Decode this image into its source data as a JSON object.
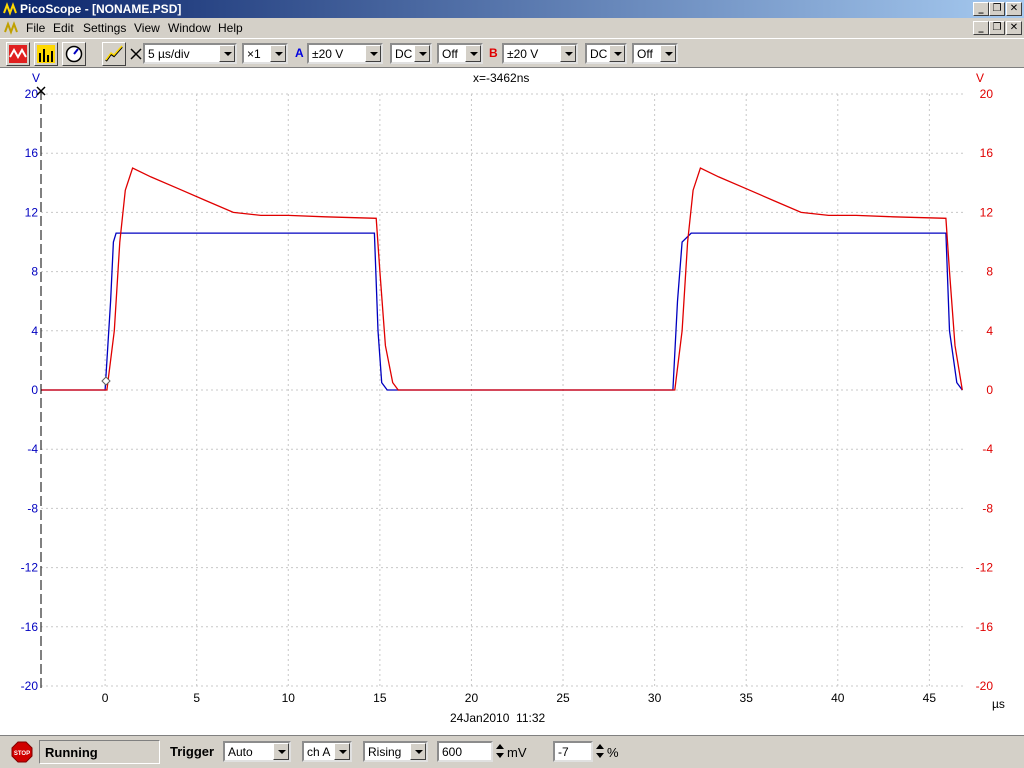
{
  "window": {
    "title": "PicoScope - [NONAME.PSD]"
  },
  "menu": {
    "items": [
      "File",
      "Edit",
      "Settings",
      "View",
      "Window",
      "Help"
    ]
  },
  "toolbar": {
    "timebase": "5 µs/div",
    "multiplier": "×1",
    "channel_a": {
      "label": "A",
      "range": "±20 V",
      "coupling": "DC",
      "offset": "Off"
    },
    "channel_b": {
      "label": "B",
      "range": "±20 V",
      "coupling": "DC",
      "offset": "Off"
    }
  },
  "plot": {
    "cursor_readout": "x=-3462ns",
    "left_unit": "V",
    "right_unit": "V",
    "x_unit": "µs",
    "timestamp": "24Jan2010  11:32"
  },
  "chart_data": {
    "type": "line",
    "xlim": [
      -3.5,
      47
    ],
    "ylim": [
      -20,
      20
    ],
    "x_ticks": [
      "0",
      "5",
      "10",
      "15",
      "20",
      "25",
      "30",
      "35",
      "40",
      "45"
    ],
    "y_ticks": [
      "20",
      "16",
      "12",
      "8",
      "4",
      "0",
      "-4",
      "-8",
      "-12",
      "-16",
      "-20"
    ],
    "grid": true,
    "series": [
      {
        "color": "#0000c0",
        "axis": "left",
        "x": [
          -3.5,
          0,
          0.3,
          0.45,
          0.6,
          5,
          10,
          14.7,
          14.9,
          15.1,
          15.4,
          20,
          30,
          31,
          31.25,
          31.5,
          32,
          40,
          45.9,
          46.1,
          46.5,
          46.8
        ],
        "y": [
          0,
          0,
          6,
          10,
          10.6,
          10.6,
          10.6,
          10.6,
          4,
          0.5,
          0,
          0,
          0,
          0,
          6,
          10,
          10.6,
          10.6,
          10.6,
          4,
          0.5,
          0
        ]
      },
      {
        "color": "#e00000",
        "axis": "left",
        "x": [
          -3.5,
          0.1,
          0.5,
          0.8,
          1.1,
          1.5,
          2.5,
          4,
          5.5,
          7,
          8.5,
          10,
          12,
          14.8,
          15,
          15.3,
          15.7,
          16,
          20,
          30,
          31.1,
          31.5,
          31.8,
          32.1,
          32.5,
          33.5,
          35,
          36.5,
          38,
          39.5,
          41,
          43,
          45.9,
          46.1,
          46.4,
          46.8
        ],
        "y": [
          0,
          0,
          4,
          10,
          13.5,
          15,
          14.4,
          13.6,
          12.8,
          12,
          11.8,
          11.8,
          11.7,
          11.6,
          8,
          3,
          0.5,
          0,
          0,
          0,
          0,
          4,
          10,
          13.5,
          15,
          14.4,
          13.6,
          12.8,
          12,
          11.8,
          11.8,
          11.7,
          11.6,
          8,
          3,
          0
        ]
      }
    ]
  },
  "status": {
    "state": "Running",
    "trigger_label": "Trigger",
    "trigger_mode": "Auto",
    "trigger_channel": "ch A",
    "trigger_edge": "Rising",
    "trigger_level": "600",
    "trigger_level_unit": "mV",
    "pretrigger": "-7",
    "pretrigger_unit": "%"
  }
}
